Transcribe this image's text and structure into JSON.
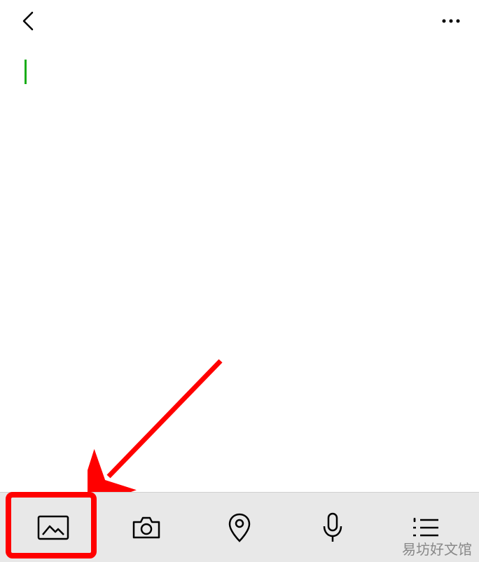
{
  "topbar": {
    "back_icon": "chevron-left",
    "more_icon": "more-horizontal"
  },
  "content": {
    "cursor_visible": true,
    "text": ""
  },
  "toolbar": {
    "items": [
      {
        "name": "gallery-icon",
        "label": "gallery"
      },
      {
        "name": "camera-icon",
        "label": "camera"
      },
      {
        "name": "location-icon",
        "label": "location"
      },
      {
        "name": "voice-icon",
        "label": "voice"
      },
      {
        "name": "list-icon",
        "label": "list"
      }
    ]
  },
  "annotation": {
    "highlighted_item": 0,
    "arrow_color": "#ff0000"
  },
  "watermark": "易坊好文馆"
}
